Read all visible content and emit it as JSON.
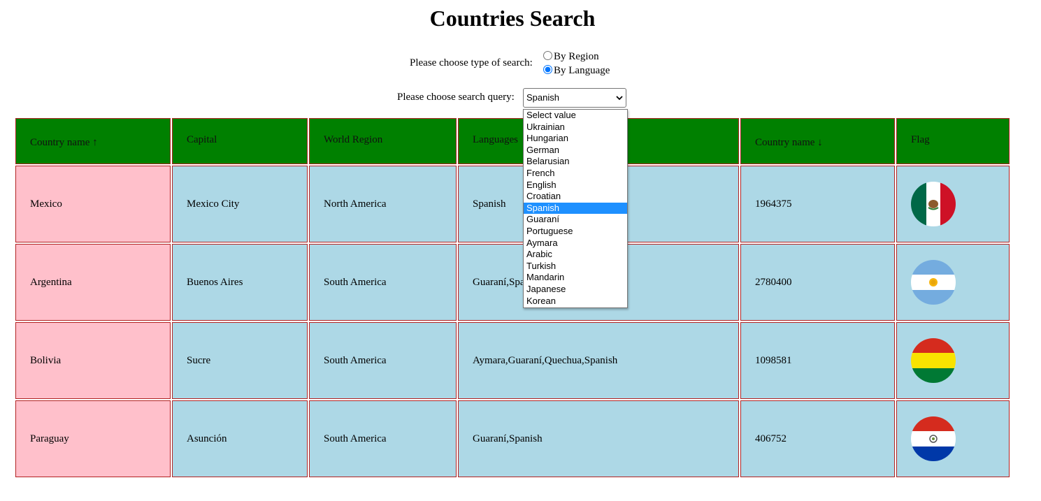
{
  "page": {
    "title": "Countries Search"
  },
  "search_type": {
    "label": "Please choose type of search:",
    "options": [
      {
        "label": "By Region",
        "checked": false
      },
      {
        "label": "By Language",
        "checked": true
      }
    ]
  },
  "search_query": {
    "label": "Please choose search query:",
    "selected": "Spanish",
    "options": [
      "Select value",
      "Ukrainian",
      "Hungarian",
      "German",
      "Belarusian",
      "French",
      "English",
      "Croatian",
      "Spanish",
      "Guaraní",
      "Portuguese",
      "Aymara",
      "Arabic",
      "Turkish",
      "Mandarin",
      "Japanese",
      "Korean"
    ]
  },
  "table": {
    "headers": [
      "Country name ↑",
      "Capital",
      "World Region",
      "Languages",
      "Country name ↓",
      "Flag"
    ],
    "rows": [
      {
        "name": "Mexico",
        "capital": "Mexico City",
        "region": "North America",
        "languages": "Spanish",
        "area": "1964375",
        "flag": "mexico-flag"
      },
      {
        "name": "Argentina",
        "capital": "Buenos Aires",
        "region": "South America",
        "languages": "Guaraní,Spanish",
        "area": "2780400",
        "flag": "argentina-flag"
      },
      {
        "name": "Bolivia",
        "capital": "Sucre",
        "region": "South America",
        "languages": "Aymara,Guaraní,Quechua,Spanish",
        "area": "1098581",
        "flag": "bolivia-flag"
      },
      {
        "name": "Paraguay",
        "capital": "Asunción",
        "region": "South America",
        "languages": "Guaraní,Spanish",
        "area": "406752",
        "flag": "paraguay-flag"
      }
    ]
  },
  "colors": {
    "header_bg": "#008000",
    "name_cell_bg": "#ffc0cb",
    "cell_bg": "#add8e6",
    "cell_border": "#b22222",
    "dropdown_highlight": "#1e90ff"
  }
}
